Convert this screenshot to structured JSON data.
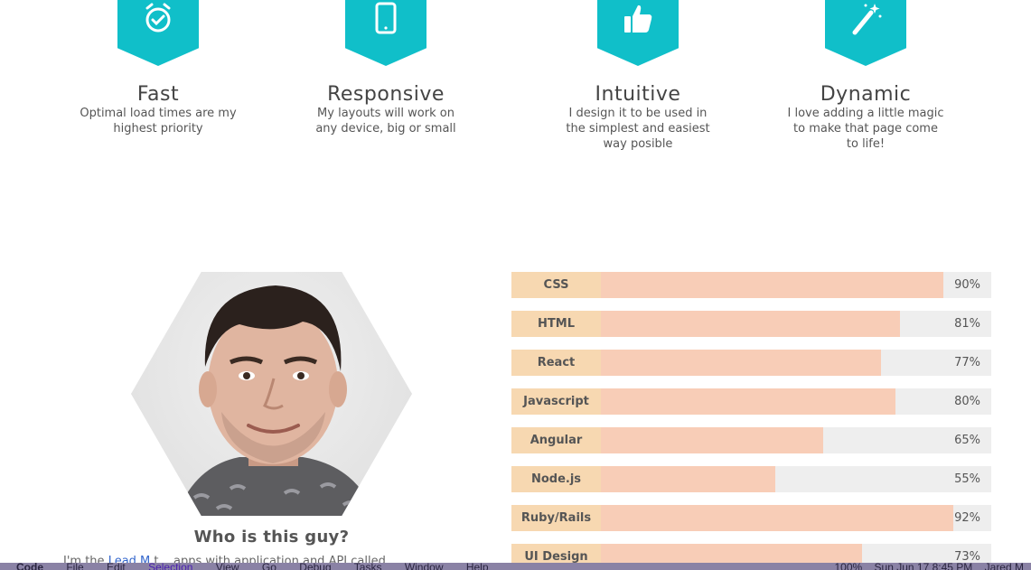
{
  "colors": {
    "accent": "#10bfc9",
    "skill_label_bg": "#f7d8b1",
    "skill_fill": "#f8cdb7",
    "skill_track": "#eeeeee",
    "menubar_bg": "#8a82a5"
  },
  "features": [
    {
      "icon": "alarm-clock-icon",
      "title": "Fast",
      "desc": "Optimal load times are my highest priority"
    },
    {
      "icon": "tablet-icon",
      "title": "Responsive",
      "desc": "My layouts will work on any device, big or small"
    },
    {
      "icon": "thumbs-up-icon",
      "title": "Intuitive",
      "desc": "I design it to be used in the simplest and easiest way posible"
    },
    {
      "icon": "magic-wand-icon",
      "title": "Dynamic",
      "desc": "I love adding a little magic to make that page come to life!"
    }
  ],
  "about": {
    "title": "Who is this guy?",
    "text_start": "I'm the",
    "text_link": "Lead M",
    "text_end": "t... apps with application and API called..."
  },
  "skills": [
    {
      "label": "CSS",
      "percent": 90,
      "percent_text": "90%"
    },
    {
      "label": "HTML",
      "percent": 81,
      "percent_text": "81%"
    },
    {
      "label": "React",
      "percent": 77,
      "percent_text": "77%"
    },
    {
      "label": "Javascript",
      "percent": 80,
      "percent_text": "80%"
    },
    {
      "label": "Angular",
      "percent": 65,
      "percent_text": "65%"
    },
    {
      "label": "Node.js",
      "percent": 55,
      "percent_text": "55%"
    },
    {
      "label": "Ruby/Rails",
      "percent": 92,
      "percent_text": "92%"
    },
    {
      "label": "UI Design",
      "percent": 73,
      "percent_text": "73%"
    }
  ],
  "menubar": {
    "app": "Code",
    "items": [
      "File",
      "Edit",
      "Selection",
      "View",
      "Go",
      "Debug",
      "Tasks",
      "Window",
      "Help"
    ],
    "battery": "100%",
    "clock": "Sun Jun 17  8:45 PM",
    "user": "Jared M"
  }
}
